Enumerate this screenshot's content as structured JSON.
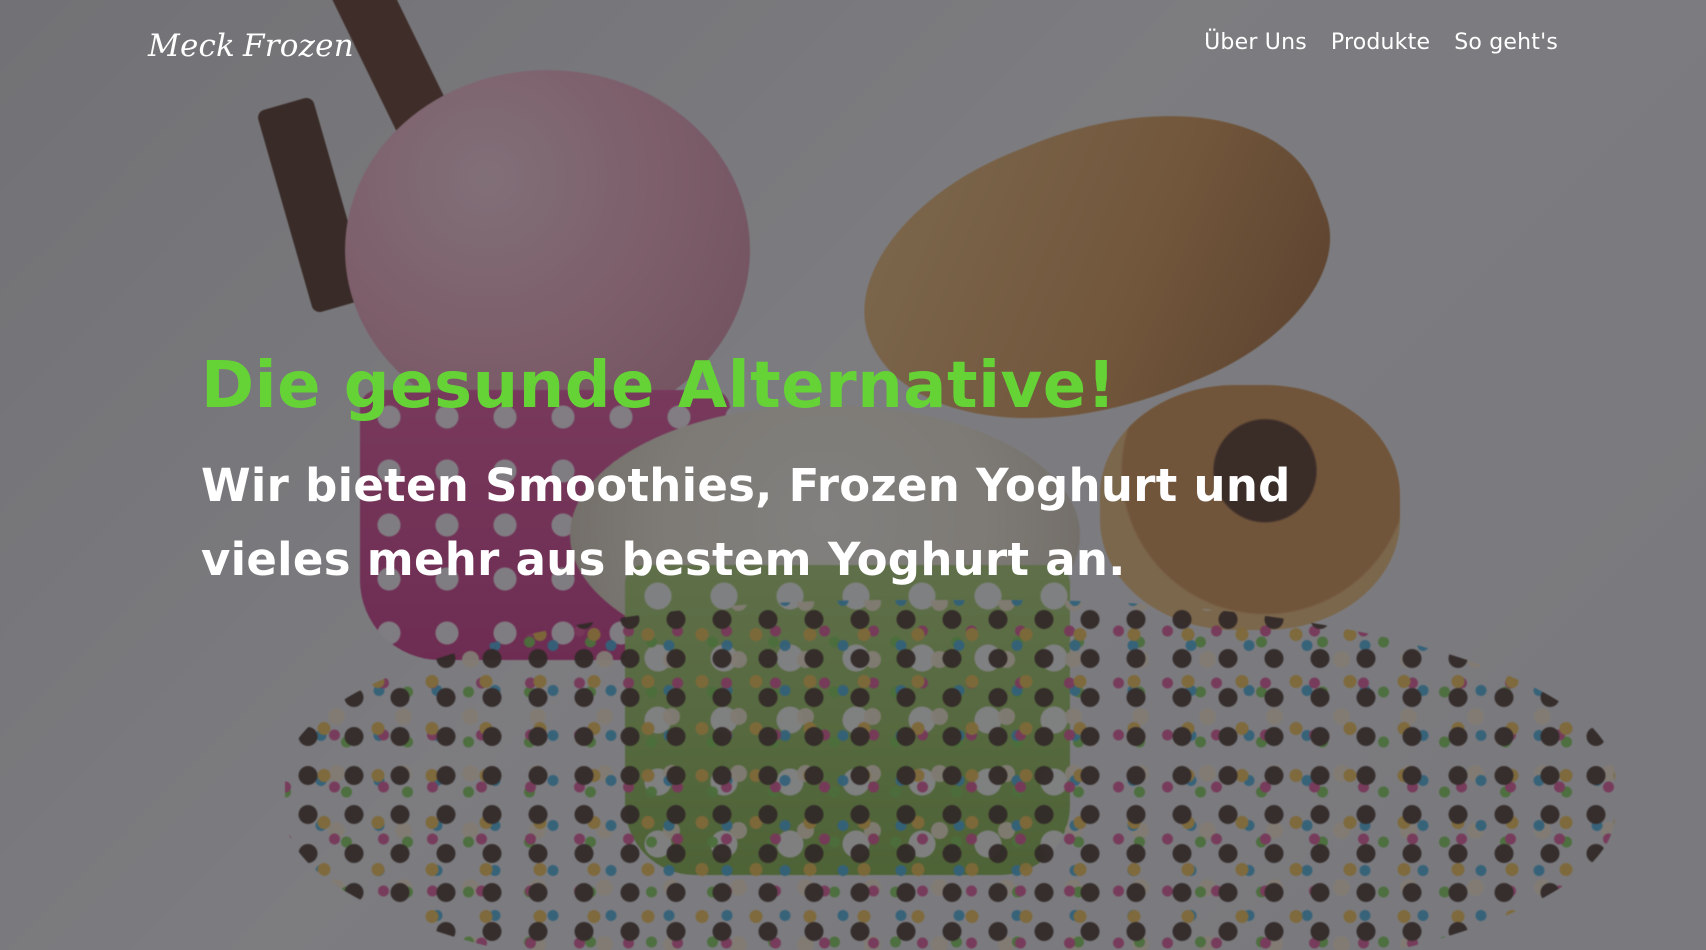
{
  "brand": {
    "left_text": "Meck",
    "right_text": "Frozen",
    "icon": "ice-cream-cone-icon"
  },
  "nav": {
    "items": [
      {
        "label": "Über Uns"
      },
      {
        "label": "Produkte"
      },
      {
        "label": "So geht's"
      }
    ]
  },
  "hero": {
    "title": "Die gesunde Alternative!",
    "subtitle": "Wir bieten Smoothies, Frozen Yoghurt und vieles mehr aus bestem Yoghurt an.",
    "background": "ice-cream-photo"
  },
  "colors": {
    "accent": "#65d336",
    "text": "#ffffff",
    "overlay": "#2d2d32"
  }
}
